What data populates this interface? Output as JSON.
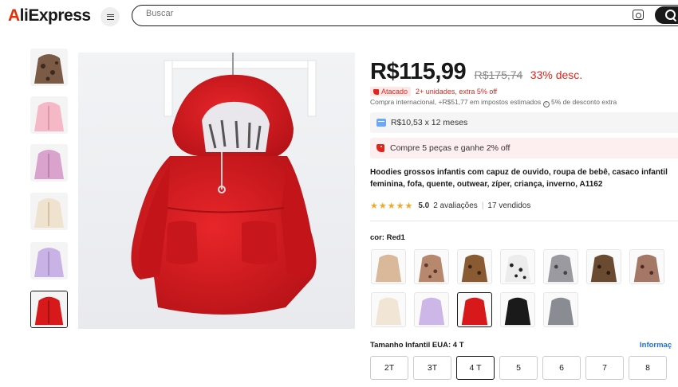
{
  "header": {
    "logo_text": "AliExpress",
    "search_placeholder": "Buscar"
  },
  "gallery": {
    "thumbnails": [
      {
        "color": "leopard",
        "hex": "#7b5b45"
      },
      {
        "color": "pink",
        "hex": "#f4b8c6"
      },
      {
        "color": "lilac",
        "hex": "#d9a3cd"
      },
      {
        "color": "beige",
        "hex": "#efe3cf"
      },
      {
        "color": "purple",
        "hex": "#c9b3e6"
      },
      {
        "color": "red",
        "hex": "#d8191b",
        "active": true
      }
    ]
  },
  "product": {
    "price": "R$115,99",
    "old_price": "R$175,74",
    "discount": "33% desc.",
    "promo_badge": "Atacado",
    "promo_text": "2+ unidades, extra 5% off",
    "tax_text": "Compra internacional, +R$51,77 em impostos estimados",
    "tax_discount": "5% de desconto extra",
    "installment": "R$10,53 x 12 meses",
    "deal": "Compre 5 peças e ganhe 2% off",
    "title_line1": "Hoodies grossos infantis com capuz de ouvido, roupa de bebê, casaco infantil",
    "title_line2": "feminina, fofa, quente, outwear, zíper, criança, inverno, A1162",
    "rating_score": "5.0",
    "reviews": "2 avaliações",
    "sold": "17 vendidos"
  },
  "colors": {
    "label": "cor: Red1",
    "swatches": [
      {
        "name": "khaki",
        "hex": "#d9b99a"
      },
      {
        "name": "leopard-pink",
        "hex": "#b7876e"
      },
      {
        "name": "leopard-brown",
        "hex": "#8a5a32"
      },
      {
        "name": "dalmatian",
        "hex": "#e8e8e8"
      },
      {
        "name": "grey-leopard",
        "hex": "#9a9aa0"
      },
      {
        "name": "brown-leopard",
        "hex": "#6b4a32"
      },
      {
        "name": "pink-leopard",
        "hex": "#a57866"
      },
      {
        "name": "beige",
        "hex": "#f1e6d6"
      },
      {
        "name": "purple",
        "hex": "#cdb6e8"
      },
      {
        "name": "red",
        "hex": "#d8191b",
        "active": true
      },
      {
        "name": "black",
        "hex": "#1a1a1a"
      },
      {
        "name": "grey",
        "hex": "#8a8c93"
      }
    ]
  },
  "sizes": {
    "label": "Tamanho Infantil EUA: 4 T",
    "link": "Informaç",
    "options": [
      "2T",
      "3T",
      "4 T",
      "5",
      "6",
      "7",
      "8"
    ],
    "selected": "4 T"
  }
}
